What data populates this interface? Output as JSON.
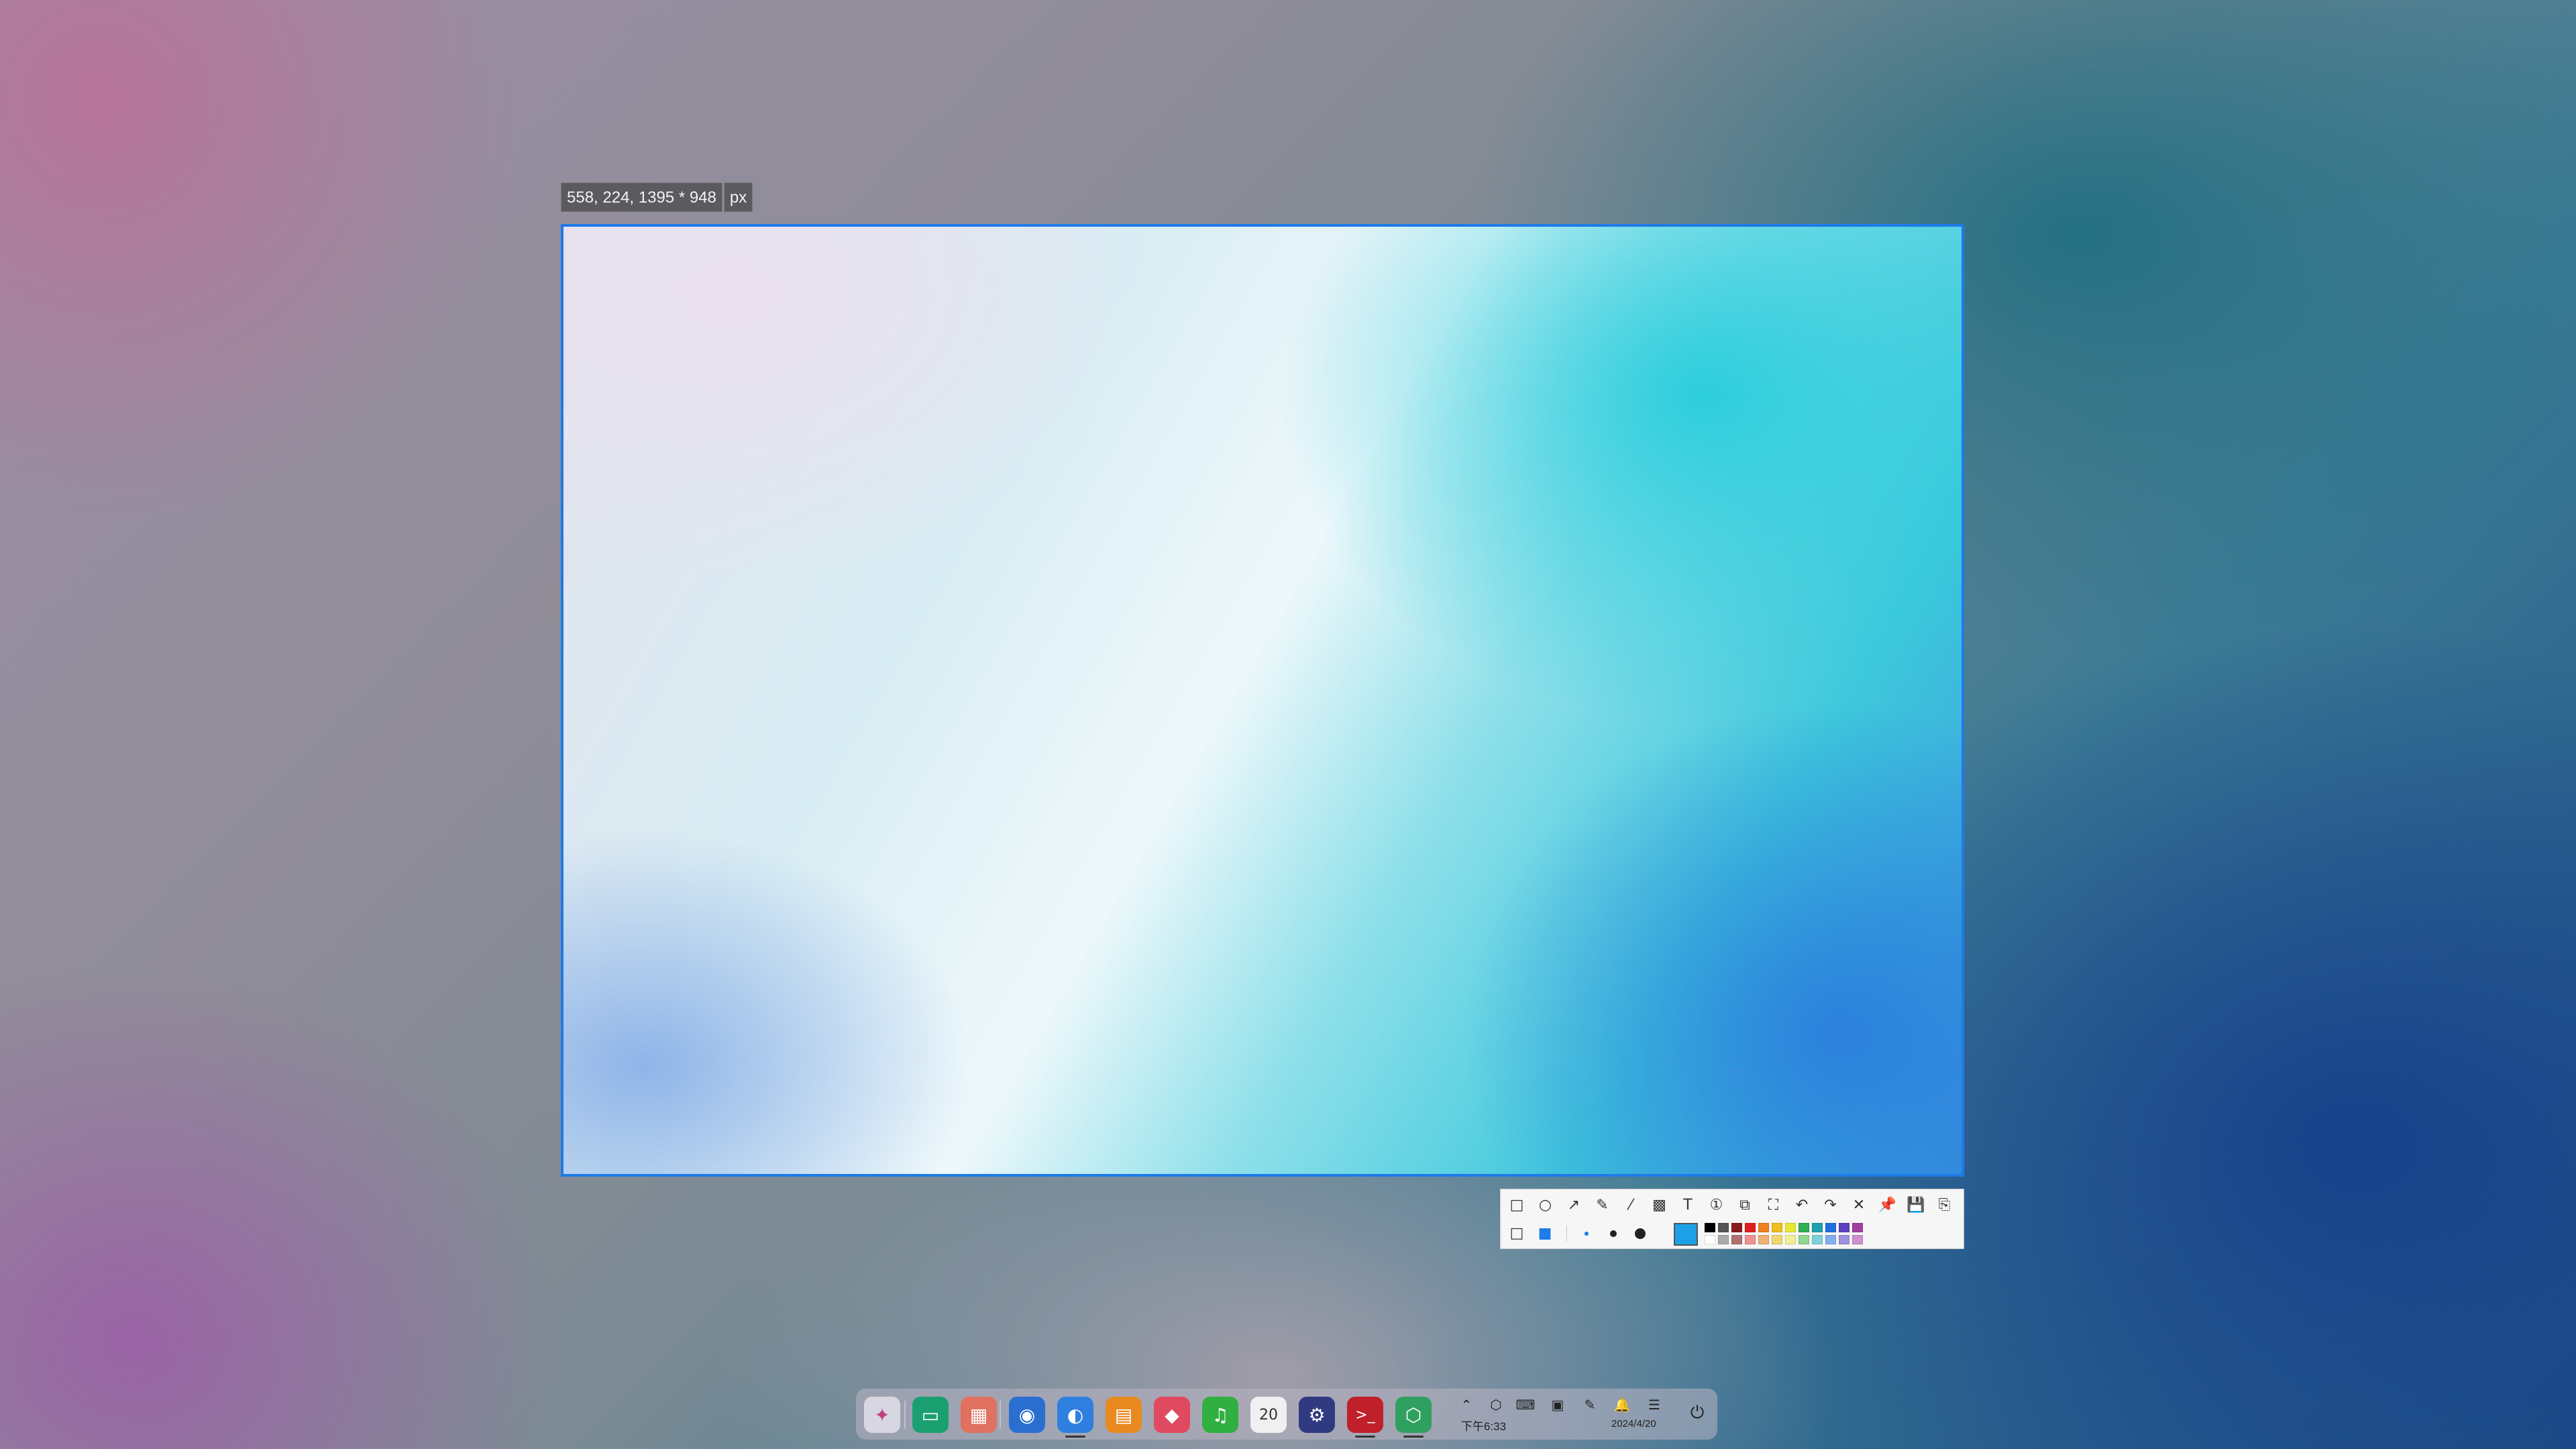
{
  "capture": {
    "size_text": "558, 224, 1395 * 948",
    "unit_text": "px"
  },
  "toolbar": {
    "row1": [
      {
        "name": "rectangle-tool",
        "glyph": "□"
      },
      {
        "name": "ellipse-tool",
        "glyph": "○"
      },
      {
        "name": "arrow-tool",
        "glyph": "↗"
      },
      {
        "name": "pen-tool",
        "glyph": "✎"
      },
      {
        "name": "marker-tool",
        "glyph": "⁄"
      },
      {
        "name": "mosaic-tool",
        "glyph": "▩"
      },
      {
        "name": "text-tool",
        "glyph": "T"
      },
      {
        "name": "number-tool",
        "glyph": "①"
      },
      {
        "name": "ocr-tool",
        "glyph": "⧉"
      },
      {
        "name": "scroll-capture-tool",
        "glyph": "⛶"
      },
      {
        "name": "undo-button",
        "glyph": "↶"
      },
      {
        "name": "redo-button",
        "glyph": "↷"
      },
      {
        "name": "cancel-button",
        "glyph": "✕"
      },
      {
        "name": "pin-button",
        "glyph": "📌"
      },
      {
        "name": "save-button",
        "glyph": "💾"
      },
      {
        "name": "copy-button",
        "glyph": "⎘"
      }
    ],
    "fill_modes": [
      {
        "name": "outline-mode",
        "glyph": "□"
      },
      {
        "name": "filled-mode",
        "glyph": "■"
      }
    ],
    "selected_color": "#1ea0e6",
    "palette_top": [
      "#000000",
      "#555555",
      "#8b1a1a",
      "#e02020",
      "#f08020",
      "#f0c020",
      "#e8e830",
      "#30b050",
      "#20a0b0",
      "#2070e0",
      "#6040c0",
      "#a040a0"
    ],
    "palette_bottom": [
      "#ffffff",
      "#aaaaaa",
      "#b07070",
      "#f09090",
      "#f0b070",
      "#f0d870",
      "#f0f090",
      "#90d890",
      "#80d0d8",
      "#80b0f0",
      "#a090e0",
      "#d090d0"
    ]
  },
  "dock": {
    "apps": [
      {
        "name": "launcher-icon",
        "glyph": "✦",
        "bg": "#d8d6e0",
        "fg": "#c04080"
      },
      {
        "name": "multitask-view-icon",
        "glyph": "▭",
        "bg": "#1aa070",
        "fg": "#ffffff"
      },
      {
        "name": "workspace-switcher-icon",
        "glyph": "▦",
        "bg": "#e07060",
        "fg": "#ffffff"
      },
      {
        "name": "app-store-icon",
        "glyph": "◉",
        "bg": "#2a6fd0",
        "fg": "#ffffff"
      },
      {
        "name": "browser-icon",
        "glyph": "◐",
        "bg": "#2f7fe0",
        "fg": "#ffffff"
      },
      {
        "name": "file-manager-icon",
        "glyph": "▤",
        "bg": "#e88a20",
        "fg": "#ffffff"
      },
      {
        "name": "photos-icon",
        "glyph": "◆",
        "bg": "#e04a60",
        "fg": "#ffffff"
      },
      {
        "name": "music-icon",
        "glyph": "♫",
        "bg": "#30b040",
        "fg": "#ffffff"
      },
      {
        "name": "calendar-icon",
        "glyph": "20",
        "bg": "#f0f0f0",
        "fg": "#333333"
      },
      {
        "name": "settings-icon",
        "glyph": "⚙",
        "bg": "#303a80",
        "fg": "#ffffff"
      },
      {
        "name": "terminal-icon",
        "glyph": ">_",
        "bg": "#c0202a",
        "fg": "#ffffff"
      },
      {
        "name": "screenshot-app-icon",
        "glyph": "⬡",
        "bg": "#30a060",
        "fg": "#ffffff"
      }
    ],
    "tray": {
      "time": "下午6:33",
      "date": "2024/4/20",
      "icons": [
        "chevron-up-icon",
        "screenshot-tray-icon",
        "keyboard-icon",
        "network-icon",
        "pen-tray-icon",
        "bell-icon",
        "control-center-icon",
        "power-icon"
      ]
    }
  }
}
